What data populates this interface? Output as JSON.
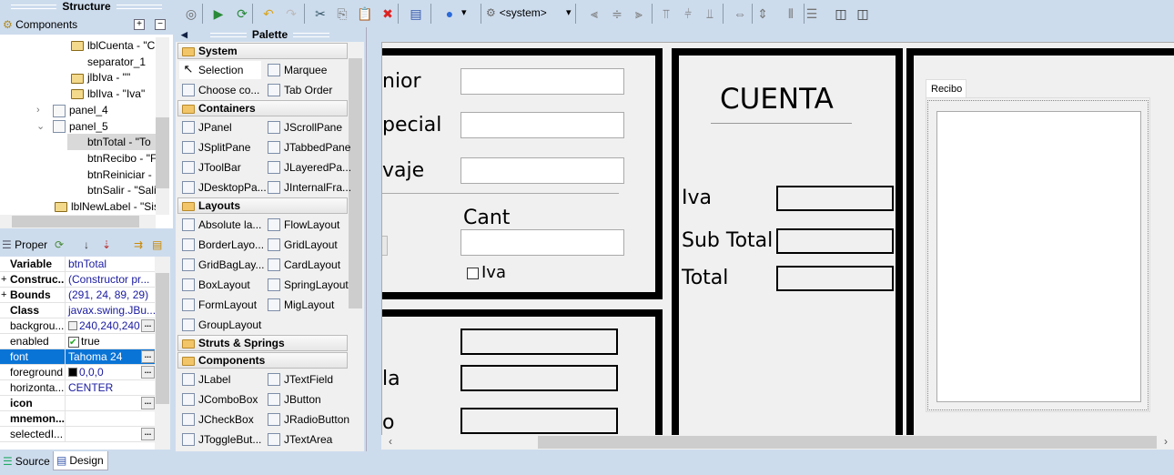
{
  "structure": {
    "title": "Structure",
    "components_label": "Components",
    "tree": [
      {
        "label": "lblCuenta - \"C",
        "type": "label"
      },
      {
        "label": "separator_1",
        "type": "separator"
      },
      {
        "label": "jlbIva - \"\"",
        "type": "label"
      },
      {
        "label": "lblIva - \"Iva\"",
        "type": "label"
      },
      {
        "label": "panel_4",
        "type": "panel",
        "expanded": false
      },
      {
        "label": "panel_5",
        "type": "panel",
        "expanded": true
      },
      {
        "label": "btnTotal - \"To",
        "type": "button",
        "selected": true
      },
      {
        "label": "btnRecibo - \"F",
        "type": "button"
      },
      {
        "label": "btnReiniciar -",
        "type": "button"
      },
      {
        "label": "btnSalir - \"Sali",
        "type": "button"
      },
      {
        "label": "lblNewLabel - \"Sis",
        "type": "label"
      }
    ]
  },
  "properties": {
    "title": "Proper",
    "rows": [
      {
        "name": "Variable",
        "value": "btnTotal",
        "bold": true
      },
      {
        "name": "Construc...",
        "value": "(Constructor pr...",
        "bold": true,
        "expand": true
      },
      {
        "name": "Bounds",
        "value": "(291, 24, 89, 29)",
        "bold": true,
        "expand": true
      },
      {
        "name": "Class",
        "value": "javax.swing.JBu...",
        "bold": true
      },
      {
        "name": "backgrou...",
        "value": "240,240,240",
        "swatch": "#f0f0f0",
        "dots": true
      },
      {
        "name": "enabled",
        "value": "true",
        "checkbox": true
      },
      {
        "name": "font",
        "value": "Tahoma 24",
        "selected": true,
        "dots": true
      },
      {
        "name": "foreground",
        "value": "0,0,0",
        "swatch": "#000000",
        "dots": true
      },
      {
        "name": "horizonta...",
        "value": "CENTER"
      },
      {
        "name": "icon",
        "value": "",
        "bold": true,
        "dots": true
      },
      {
        "name": "mnemon...",
        "value": "",
        "bold": true
      },
      {
        "name": "selectedI...",
        "value": "",
        "dots": true
      }
    ]
  },
  "bottom_tabs": [
    {
      "label": "Source"
    },
    {
      "label": "Design",
      "active": true
    }
  ],
  "palette": {
    "title": "Palette",
    "categories": [
      {
        "name": "System",
        "items": [
          "Selection",
          "Marquee",
          "Choose co...",
          "Tab Order"
        ]
      },
      {
        "name": "Containers",
        "items": [
          "JPanel",
          "JScrollPane",
          "JSplitPane",
          "JTabbedPane",
          "JToolBar",
          "JLayeredPa...",
          "JDesktopPa...",
          "JInternalFra..."
        ]
      },
      {
        "name": "Layouts",
        "items": [
          "Absolute la...",
          "FlowLayout",
          "BorderLayo...",
          "GridLayout",
          "GridBagLay...",
          "CardLayout",
          "BoxLayout",
          "SpringLayout",
          "FormLayout",
          "MigLayout",
          "GroupLayout"
        ]
      },
      {
        "name": "Struts & Springs",
        "items": []
      },
      {
        "name": "Components",
        "items": [
          "JLabel",
          "JTextField",
          "JComboBox",
          "JButton",
          "JCheckBox",
          "JRadioButton",
          "JToggleBut...",
          "JTextArea"
        ]
      }
    ]
  },
  "toolbar": {
    "look_and_feel": "<system>",
    "icons": [
      "test-gui-icon",
      "form-icon",
      "refresh-icon",
      "undo-icon",
      "redo-icon",
      "cut-icon",
      "copy-icon",
      "paste-icon",
      "delete-icon",
      "tab-order-icon",
      "globe-icon",
      "align-left-icon",
      "align-center-icon",
      "align-right-icon",
      "align-top-icon",
      "align-middle-icon",
      "align-bottom-icon",
      "same-width-icon",
      "same-height-icon",
      "space-horizontal-icon",
      "space-vertical-icon",
      "center-horizontal-icon",
      "center-vertical-icon"
    ]
  },
  "canvas": {
    "panel1": {
      "labels": [
        "nior",
        "pecial",
        "vaje"
      ],
      "cant_label": "Cant",
      "checkbox_label": "Iva"
    },
    "panel2": {
      "labels": [
        "la",
        "o"
      ]
    },
    "cuenta": {
      "title": "CUENTA",
      "iva": "Iva",
      "subtotal": "Sub Total",
      "total": "Total"
    },
    "recibo": {
      "tab": "Recibo"
    }
  }
}
